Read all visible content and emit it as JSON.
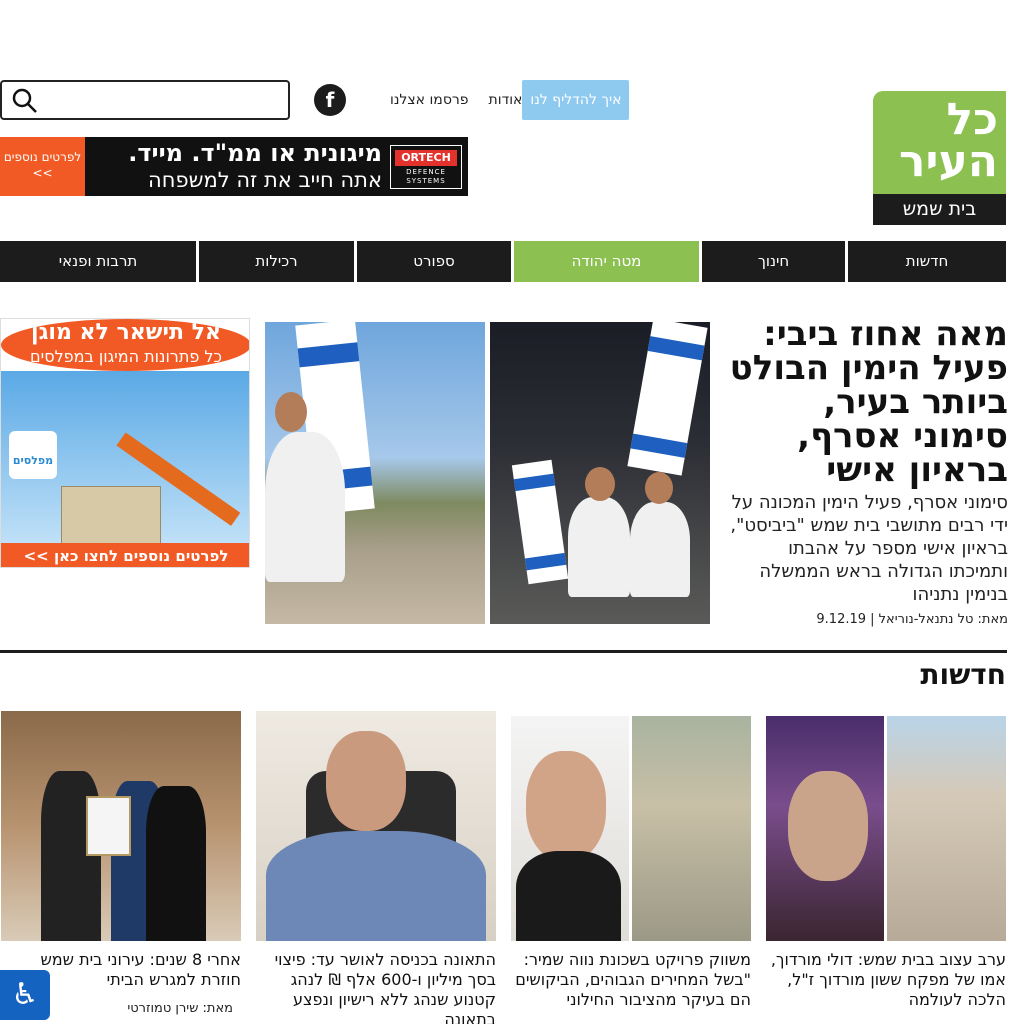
{
  "logo": {
    "name": "כל העיר",
    "city": "בית שמש"
  },
  "header": {
    "links": [
      "פרסמו אצלנו",
      "אודות"
    ],
    "tip_button": "איך להדליף לנו",
    "facebook": "f"
  },
  "search": {
    "placeholder": ""
  },
  "ad_top": {
    "line1": "מיגונית או ממ\"ד. מייד.",
    "line2": "אתה חייב את זה למשפחה",
    "more": "לפרטים נוספים >>",
    "brand": "ORTECH",
    "brand_sub": "DEFENCE SYSTEMS"
  },
  "nav": {
    "items": [
      "חדשות",
      "חינוך",
      "מטה יהודה",
      "ספורט",
      "רכילות",
      "תרבות ופנאי"
    ],
    "active": "מטה יהודה"
  },
  "ad_side": {
    "headline": "אל תישאר לא מוגן",
    "sub": "כל פתרונות המיגון במפלסים",
    "logo": "מפלסים",
    "cta": "לפרטים נוספים לחצו כאן >>"
  },
  "hero": {
    "title": "מאה אחוז ביבי: פעיל הימין הבולט ביותר בעיר, סימוני אסרף, בראיון אישי",
    "summary": "סימוני אסרף, פעיל הימין המכונה על ידי רבים מתושבי בית שמש \"ביביסט\", בראיון אישי מספר על אהבתו ותמיכתו הגדולה בראש הממשלה בנימין נתניהו",
    "author": "מאת: טל נתנאל-נוריאל",
    "date": "9.12.19"
  },
  "section": {
    "title": "חדשות"
  },
  "news": [
    {
      "title": "ערב עצוב בבית שמש: דולי מורדוך, אמו של מפקח ששון מורדוך ז\"ל, הלכה לעולמה",
      "author": ""
    },
    {
      "title": "משווק פרויקט בשכונת נווה שמיר: \"בשל המחירים הגבוהים, הביקושים הם בעיקר מהציבור החילוני",
      "author": ""
    },
    {
      "title": "התאונה בכניסה לאושר עד: פיצוי בסך מיליון ו-600 אלף ₪ לנהג קטנוע שנהג ללא רישיון ונפצע בתאונה",
      "author": ""
    },
    {
      "title": "אחרי 8 שנים: עירוני בית שמש חוזרת למגרש הביתי",
      "author": "מאת: שירן טמוזרטי"
    }
  ],
  "accessibility": {
    "icon": "wheelchair-icon"
  },
  "colors": {
    "brand_green": "#8cc152",
    "dark": "#1c1c1c",
    "orange": "#f15a24",
    "light_blue": "#8ec9f0"
  }
}
